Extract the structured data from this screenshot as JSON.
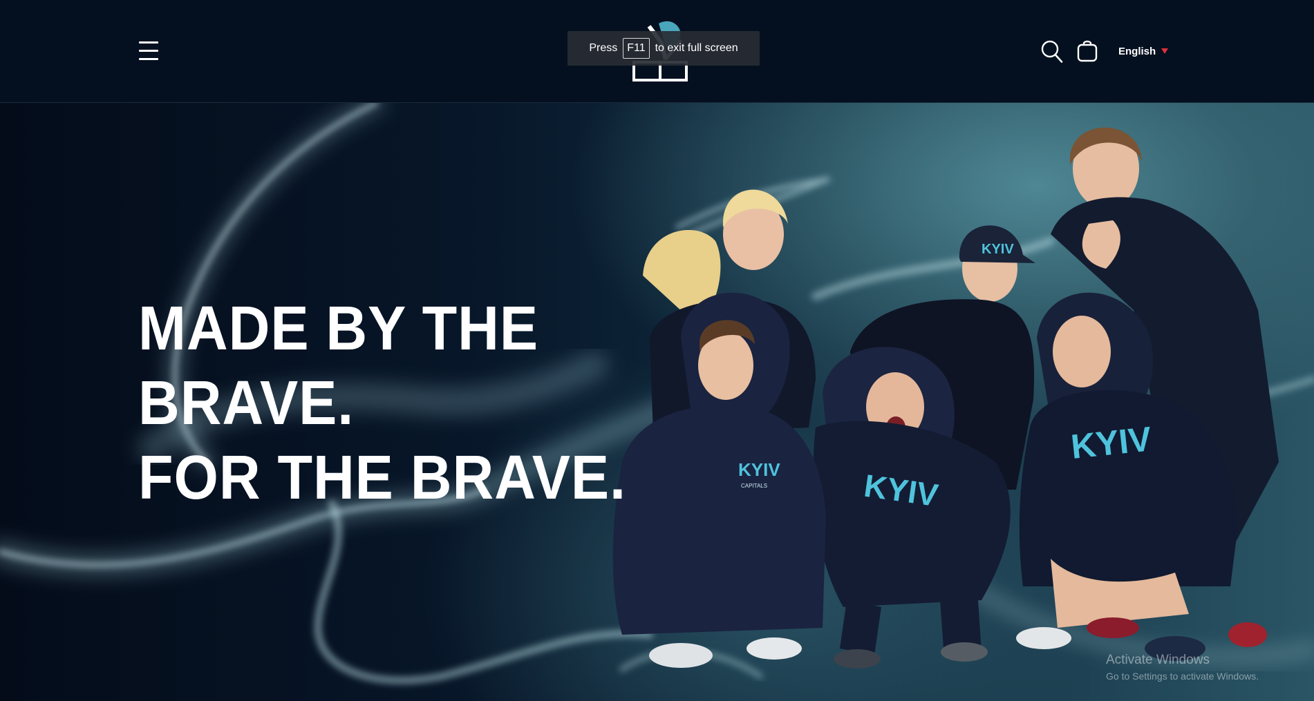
{
  "header": {
    "menu_icon": "hamburger-menu-icon",
    "logo_icon": "k-logo-icon",
    "search_icon": "search-icon",
    "cart_icon": "shopping-bag-icon",
    "language": {
      "label": "English",
      "arrow_icon": "caret-down-icon",
      "arrow_color": "#e0303a"
    }
  },
  "fullscreen_notice": {
    "prefix": "Press",
    "key": "F11",
    "suffix": "to exit full screen"
  },
  "hero": {
    "headline": {
      "line1": "MADE BY THE",
      "line2": "BRAVE.",
      "line3": "FOR THE BRAVE."
    },
    "photo": {
      "subject": "five-people-in-navy-kyiv-capitals-hoodies",
      "print_text": "KYIV",
      "print_subtext": "CAPITALS",
      "print_color": "#4fc3dc"
    }
  },
  "os_watermark": {
    "title": "Activate Windows",
    "subtitle": "Go to Settings to activate Windows."
  },
  "colors": {
    "header_bg": "#04101f",
    "accent_red": "#e0303a",
    "text": "#ffffff"
  }
}
